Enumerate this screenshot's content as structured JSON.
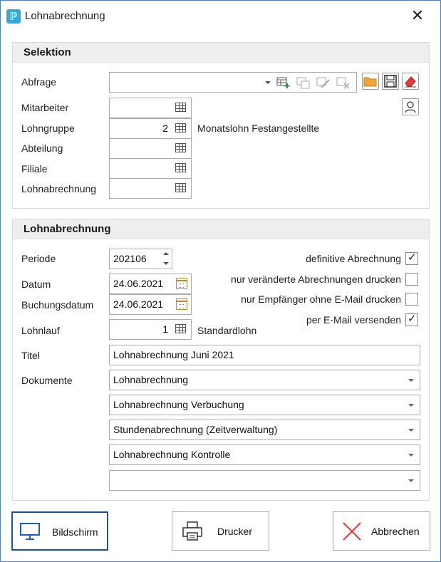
{
  "window": {
    "title": "Lohnabrechnung",
    "app_icon_glyph": "ℙ",
    "close_glyph": "✕"
  },
  "selektion": {
    "header": "Selektion",
    "abfrage_label": "Abfrage",
    "abfrage_value": "",
    "mitarbeiter_label": "Mitarbeiter",
    "mitarbeiter_value": "",
    "lohngruppe_label": "Lohngruppe",
    "lohngruppe_value": "2",
    "lohngruppe_desc": "Monatslohn Festangestellte",
    "abteilung_label": "Abteilung",
    "abteilung_value": "",
    "filiale_label": "Filiale",
    "filiale_value": "",
    "lohnabrechnung_label": "Lohnabrechnung",
    "lohnabrechnung_value": ""
  },
  "lohnabrechnung": {
    "header": "Lohnabrechnung",
    "periode_label": "Periode",
    "periode_value": "202106",
    "datum_label": "Datum",
    "datum_value": "24.06.2021",
    "buchungsdatum_label": "Buchungsdatum",
    "buchungsdatum_value": "24.06.2021",
    "lohnlauf_label": "Lohnlauf",
    "lohnlauf_value": "1",
    "lohnlauf_desc": "Standardlohn",
    "titel_label": "Titel",
    "titel_value": "Lohnabrechnung Juni 2021",
    "dokumente_label": "Dokumente",
    "dokumente": [
      "Lohnabrechnung",
      "Lohnabrechnung Verbuchung",
      "Stundenabrechnung (Zeitverwaltung)",
      "Lohnabrechnung Kontrolle",
      ""
    ],
    "options": [
      {
        "label": "definitive Abrechnung",
        "checked": true
      },
      {
        "label": "nur veränderte Abrechnungen drucken",
        "checked": false
      },
      {
        "label": "nur Empfänger ohne E-Mail drucken",
        "checked": false
      },
      {
        "label": "per E-Mail versenden",
        "checked": true
      }
    ],
    "check_glyph": "✓"
  },
  "buttons": {
    "bildschirm": "Bildschirm",
    "drucker": "Drucker",
    "abbrechen": "Abbrechen"
  },
  "colors": {
    "accent_border": "#1f4e99",
    "cancel_x": "#e23b3b",
    "folder": "#f2a53a",
    "monitor": "#1f5fb8"
  }
}
